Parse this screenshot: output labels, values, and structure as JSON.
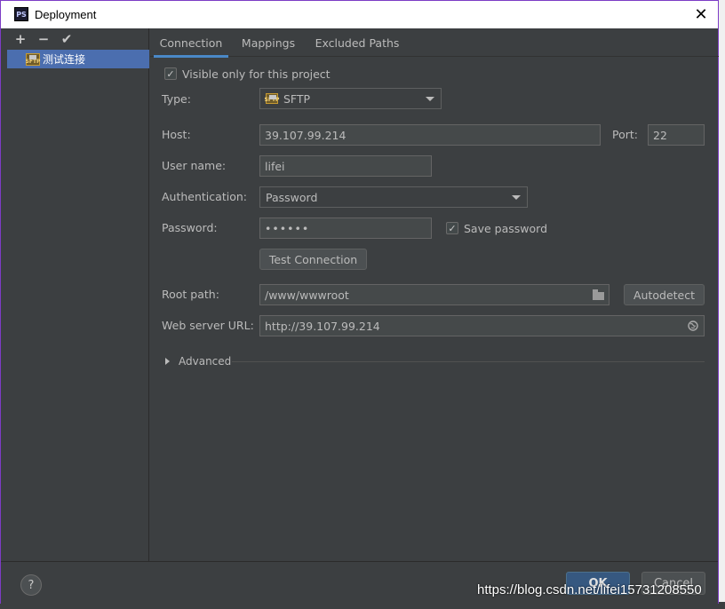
{
  "window": {
    "title": "Deployment",
    "app_icon": "PS"
  },
  "sidebar": {
    "toolbar": {
      "add": "+",
      "remove": "−",
      "confirm": "✔"
    },
    "server": {
      "name": "测试连接",
      "icon": "sftp-server-icon"
    }
  },
  "tabs": [
    {
      "label": "Connection",
      "active": true
    },
    {
      "label": "Mappings",
      "active": false
    },
    {
      "label": "Excluded Paths",
      "active": false
    }
  ],
  "connection": {
    "visible_only": {
      "label": "Visible only for this project",
      "checked": true
    },
    "type": {
      "label": "Type:",
      "value": "SFTP"
    },
    "host": {
      "label": "Host:",
      "value": "39.107.99.214"
    },
    "port": {
      "label": "Port:",
      "value": "22"
    },
    "username": {
      "label": "User name:",
      "value": "lifei"
    },
    "auth": {
      "label": "Authentication:",
      "value": "Password"
    },
    "password": {
      "label": "Password:",
      "value": "••••••"
    },
    "save_password": {
      "label": "Save password",
      "checked": true
    },
    "test_connection": "Test Connection",
    "root_path": {
      "label": "Root path:",
      "value": "/www/wwwroot"
    },
    "autodetect": "Autodetect",
    "web_url": {
      "label": "Web server URL:",
      "value": "http://39.107.99.214"
    },
    "advanced": "Advanced"
  },
  "footer": {
    "help": "?",
    "ok": "OK",
    "cancel": "Cancel"
  },
  "watermark": "https://blog.csdn.net/lifei15731208550",
  "colors": {
    "accent": "#4a88c7",
    "selection": "#4b6eaf",
    "ok_button": "#365880"
  }
}
